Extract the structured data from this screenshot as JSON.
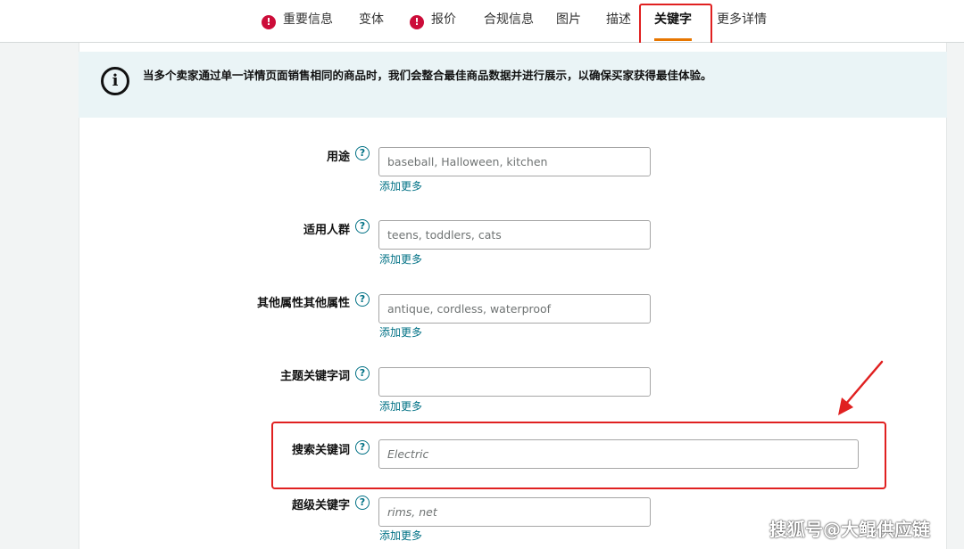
{
  "tabs": [
    {
      "label": "重要信息",
      "warning": true
    },
    {
      "label": "变体",
      "warning": false
    },
    {
      "label": "报价",
      "warning": true
    },
    {
      "label": "合规信息",
      "warning": false
    },
    {
      "label": "图片",
      "warning": false
    },
    {
      "label": "描述",
      "warning": false
    },
    {
      "label": "关键字",
      "warning": false,
      "active": true
    },
    {
      "label": "更多详情",
      "warning": false
    }
  ],
  "warning_glyph": "!",
  "info": {
    "icon_glyph": "i",
    "text": "当多个卖家通过单一详情页面销售相同的商品时，我们会整合最佳商品数据并进行展示，以确保买家获得最佳体验。"
  },
  "help_glyph": "?",
  "add_more_label": "添加更多",
  "fields": [
    {
      "label": "用途",
      "placeholder": "baseball, Halloween, kitchen"
    },
    {
      "label": "适用人群",
      "placeholder": "teens, toddlers, cats"
    },
    {
      "label": "其他属性其他属性",
      "placeholder": "antique, cordless, waterproof"
    },
    {
      "label": "主题关键字词",
      "placeholder": ""
    },
    {
      "label": "搜索关键词",
      "placeholder": "Electric"
    },
    {
      "label": "超级关键字",
      "placeholder": "rims, net"
    }
  ],
  "watermark": "搜狐号@大鲲供应链",
  "colors": {
    "accent_link": "#007185",
    "warning": "#cc0c39",
    "annotation_red": "#e02020",
    "info_bg": "#eaf4f6"
  }
}
